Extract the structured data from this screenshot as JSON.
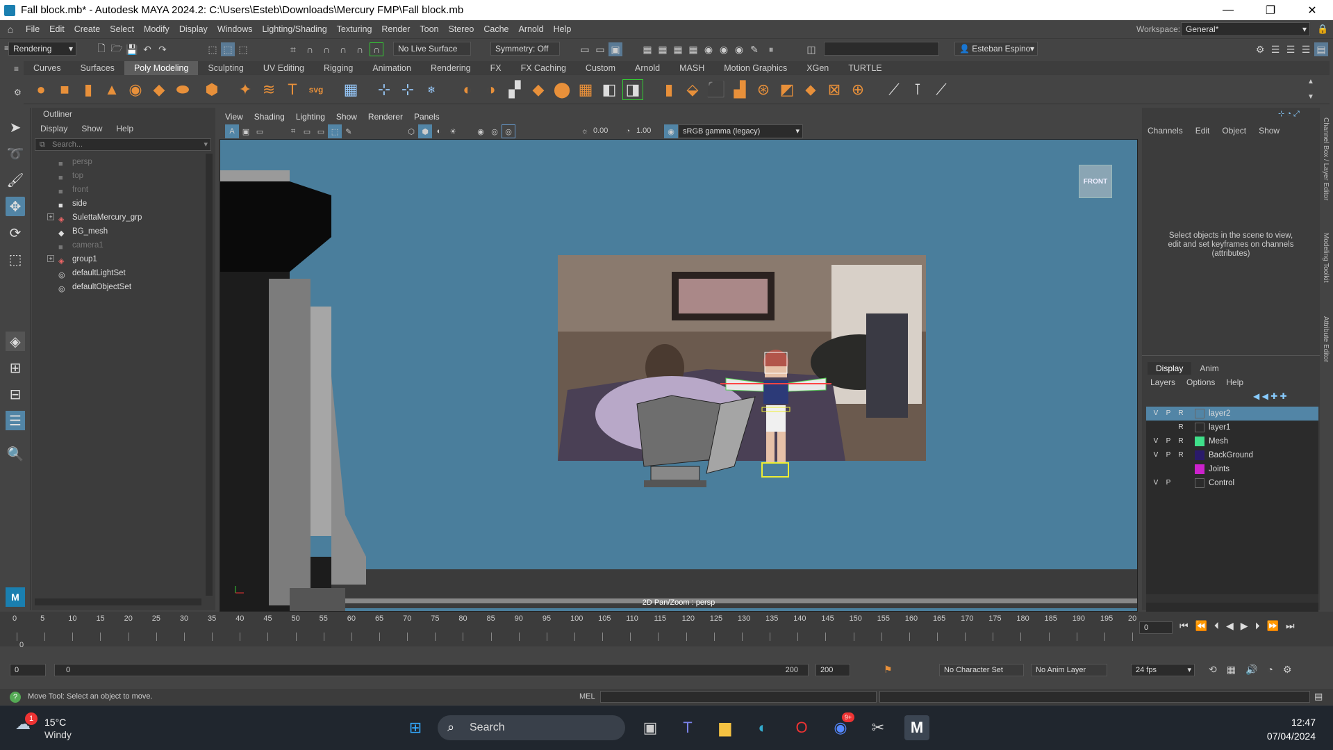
{
  "window": {
    "title": "Fall block.mb* - Autodesk MAYA 2024.2: C:\\Users\\Esteb\\Downloads\\Mercury FMP\\Fall block.mb"
  },
  "menubar": [
    "File",
    "Edit",
    "Create",
    "Select",
    "Modify",
    "Display",
    "Windows",
    "Lighting/Shading",
    "Texturing",
    "Render",
    "Toon",
    "Stereo",
    "Cache",
    "Arnold",
    "Help"
  ],
  "workspace": {
    "label": "Workspace:",
    "value": "General*"
  },
  "status": {
    "menuset": "Rendering",
    "live_surface": "No Live Surface",
    "symmetry": "Symmetry: Off",
    "user": "Esteban Espino"
  },
  "shelf_tabs": [
    "Curves",
    "Surfaces",
    "Poly Modeling",
    "Sculpting",
    "UV Editing",
    "Rigging",
    "Animation",
    "Rendering",
    "FX",
    "FX Caching",
    "Custom",
    "Arnold",
    "MASH",
    "Motion Graphics",
    "XGen",
    "TURTLE"
  ],
  "shelf_active": "Poly Modeling",
  "outliner": {
    "title": "Outliner",
    "menu": [
      "Display",
      "Show",
      "Help"
    ],
    "search_placeholder": "Search...",
    "items": [
      {
        "label": "persp",
        "icon": "camera-icon",
        "dim": true,
        "expand": false
      },
      {
        "label": "top",
        "icon": "camera-icon",
        "dim": true,
        "expand": false
      },
      {
        "label": "front",
        "icon": "camera-icon",
        "dim": true,
        "expand": false
      },
      {
        "label": "side",
        "icon": "camera-icon",
        "dim": false,
        "expand": false
      },
      {
        "label": "SulettaMercury_grp",
        "icon": "group-icon",
        "dim": false,
        "expand": true
      },
      {
        "label": "BG_mesh",
        "icon": "mesh-icon",
        "dim": false,
        "expand": false
      },
      {
        "label": "camera1",
        "icon": "camera-icon",
        "dim": true,
        "expand": false
      },
      {
        "label": "group1",
        "icon": "group-icon",
        "dim": false,
        "expand": true
      },
      {
        "label": "defaultLightSet",
        "icon": "set-icon",
        "dim": false,
        "expand": false
      },
      {
        "label": "defaultObjectSet",
        "icon": "set-icon",
        "dim": false,
        "expand": false
      }
    ]
  },
  "viewport": {
    "menu": [
      "View",
      "Shading",
      "Lighting",
      "Show",
      "Renderer",
      "Panels"
    ],
    "exposure": "0.00",
    "gamma": "1.00",
    "colorspace": "sRGB gamma (legacy)",
    "view_cube": "FRONT",
    "hud": "2D Pan/Zoom : persp"
  },
  "channelbox": {
    "menu": [
      "Channels",
      "Edit",
      "Object",
      "Show"
    ],
    "message": "Select objects in the scene to view, edit and set keyframes on channels (attributes)"
  },
  "layers": {
    "tabs": [
      "Display",
      "Anim"
    ],
    "menu": [
      "Layers",
      "Options",
      "Help"
    ],
    "rows": [
      {
        "v": "V",
        "p": "P",
        "r": "R",
        "name": "layer2",
        "color": "",
        "selected": true
      },
      {
        "v": "",
        "p": "",
        "r": "R",
        "name": "layer1",
        "color": "",
        "selected": false
      },
      {
        "v": "V",
        "p": "P",
        "r": "R",
        "name": "Mesh",
        "color": "#3fe08a",
        "selected": false
      },
      {
        "v": "V",
        "p": "P",
        "r": "R",
        "name": "BackGround",
        "color": "#2a1a6a",
        "selected": false
      },
      {
        "v": "",
        "p": "",
        "r": "",
        "name": "Joints",
        "color": "#cc22cc",
        "selected": false
      },
      {
        "v": "V",
        "p": "P",
        "r": "",
        "name": "Control",
        "color": "",
        "selected": false
      }
    ]
  },
  "side_tabs": [
    "Channel Box / Layer Editor",
    "Modeling Toolkit",
    "Attribute Editor"
  ],
  "timeline": {
    "ticks": [
      "0",
      "5",
      "10",
      "15",
      "20",
      "25",
      "30",
      "35",
      "40",
      "45",
      "50",
      "55",
      "60",
      "65",
      "70",
      "75",
      "80",
      "85",
      "90",
      "95",
      "100",
      "105",
      "110",
      "115",
      "120",
      "125",
      "130",
      "135",
      "140",
      "145",
      "150",
      "155",
      "160",
      "165",
      "170",
      "175",
      "180",
      "185",
      "190",
      "195",
      "20"
    ],
    "current_frame": "0",
    "frame_field": "0"
  },
  "range": {
    "start": "0",
    "inner_start": "0",
    "inner_end": "200",
    "end": "200",
    "character_set": "No Character Set",
    "anim_layer": "No Anim Layer",
    "fps": "24 fps"
  },
  "helpline": {
    "text": "Move Tool: Select an object to move.",
    "mel": "MEL"
  },
  "taskbar": {
    "weather_temp": "15°C",
    "weather_desc": "Windy",
    "weather_badge": "1",
    "search": "Search",
    "discord_badge": "9+",
    "time": "12:47",
    "date": "07/04/2024"
  }
}
